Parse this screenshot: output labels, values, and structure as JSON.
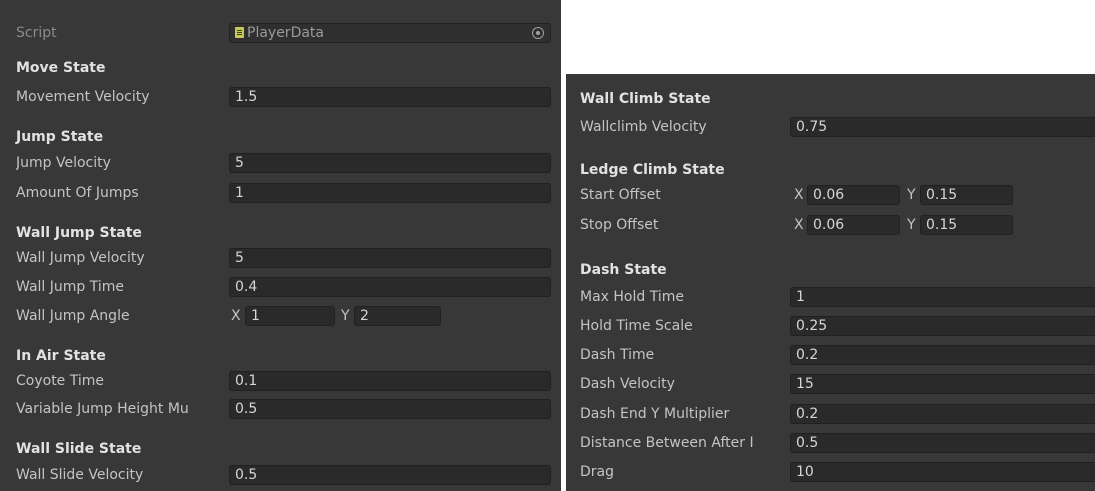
{
  "left": {
    "script": {
      "label": "Script",
      "value": "PlayerData"
    },
    "move_state": {
      "header": "Move State",
      "movement_velocity": {
        "label": "Movement Velocity",
        "value": "1.5"
      }
    },
    "jump_state": {
      "header": "Jump State",
      "jump_velocity": {
        "label": "Jump Velocity",
        "value": "5"
      },
      "amount_of_jumps": {
        "label": "Amount Of Jumps",
        "value": "1"
      }
    },
    "wall_jump_state": {
      "header": "Wall Jump State",
      "wall_jump_velocity": {
        "label": "Wall Jump Velocity",
        "value": "5"
      },
      "wall_jump_time": {
        "label": "Wall Jump Time",
        "value": "0.4"
      },
      "wall_jump_angle": {
        "label": "Wall Jump Angle",
        "x_label": "X",
        "x": "1",
        "y_label": "Y",
        "y": "2"
      }
    },
    "in_air_state": {
      "header": "In Air State",
      "coyote_time": {
        "label": "Coyote Time",
        "value": "0.1"
      },
      "variable_jump_height": {
        "label": "Variable Jump Height Mu",
        "value": "0.5"
      }
    },
    "wall_slide_state": {
      "header": "Wall Slide State",
      "wall_slide_velocity": {
        "label": "Wall Slide Velocity",
        "value": "0.5"
      }
    }
  },
  "right": {
    "wall_climb_state": {
      "header": "Wall Climb State",
      "wallclimb_velocity": {
        "label": "Wallclimb Velocity",
        "value": "0.75"
      }
    },
    "ledge_climb_state": {
      "header": "Ledge Climb State",
      "start_offset": {
        "label": "Start Offset",
        "x_label": "X",
        "x": "0.06",
        "y_label": "Y",
        "y": "0.15"
      },
      "stop_offset": {
        "label": "Stop Offset",
        "x_label": "X",
        "x": "0.06",
        "y_label": "Y",
        "y": "0.15"
      }
    },
    "dash_state": {
      "header": "Dash State",
      "max_hold_time": {
        "label": "Max Hold Time",
        "value": "1"
      },
      "hold_time_scale": {
        "label": "Hold Time Scale",
        "value": "0.25"
      },
      "dash_time": {
        "label": "Dash Time",
        "value": "0.2"
      },
      "dash_velocity": {
        "label": "Dash Velocity",
        "value": "15"
      },
      "dash_end_y_multiplier": {
        "label": "Dash End Y Multiplier",
        "value": "0.2"
      },
      "distance_between_after": {
        "label": "Distance Between After I",
        "value": "0.5"
      },
      "drag": {
        "label": "Drag",
        "value": "10"
      }
    }
  }
}
